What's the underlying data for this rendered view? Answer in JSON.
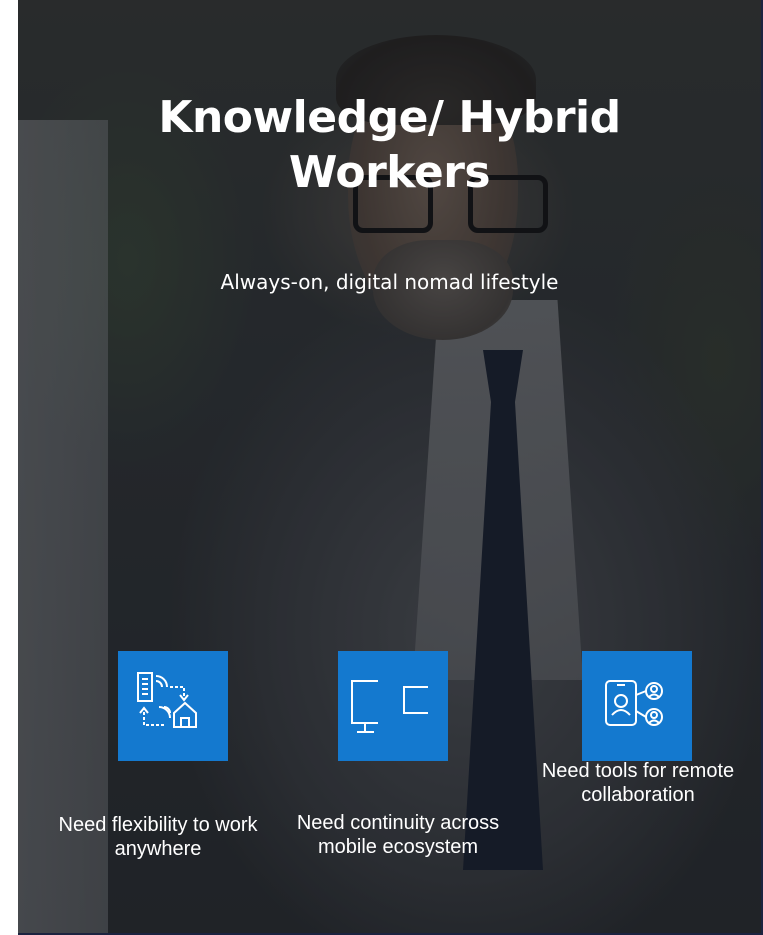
{
  "slide": {
    "title": "Knowledge/ Hybrid Workers",
    "subtitle": "Always-on, digital nomad lifestyle",
    "accent_color": "#1479cf",
    "needs": [
      {
        "icon": "building-home-sync-icon",
        "caption": "Need flexibility to work anywhere"
      },
      {
        "icon": "monitor-phone-icon",
        "caption": "Need continuity across mobile ecosystem"
      },
      {
        "icon": "remote-collaboration-icon",
        "caption": "Need tools for remote collaboration"
      }
    ]
  }
}
